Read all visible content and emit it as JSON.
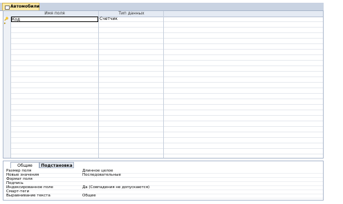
{
  "window": {
    "tab_title": "Автомобили"
  },
  "table": {
    "columns": [
      "Имя поля",
      "Тип данных"
    ],
    "rows": [
      {
        "field_name": "Код",
        "data_type": "Счетчик"
      }
    ]
  },
  "properties": {
    "tabs": [
      "Общие",
      "Подстановка"
    ],
    "items": [
      {
        "label": "Размер поля",
        "value": "Длинное целое"
      },
      {
        "label": "Новые значения",
        "value": "Последовательные"
      },
      {
        "label": "Формат поля",
        "value": ""
      },
      {
        "label": "Подпись",
        "value": ""
      },
      {
        "label": "Индексированное поле",
        "value": "Да (Совпадения не допускаются)"
      },
      {
        "label": "Смарт-теги",
        "value": ""
      },
      {
        "label": "Выравнивание текста",
        "value": "Общее"
      }
    ]
  }
}
